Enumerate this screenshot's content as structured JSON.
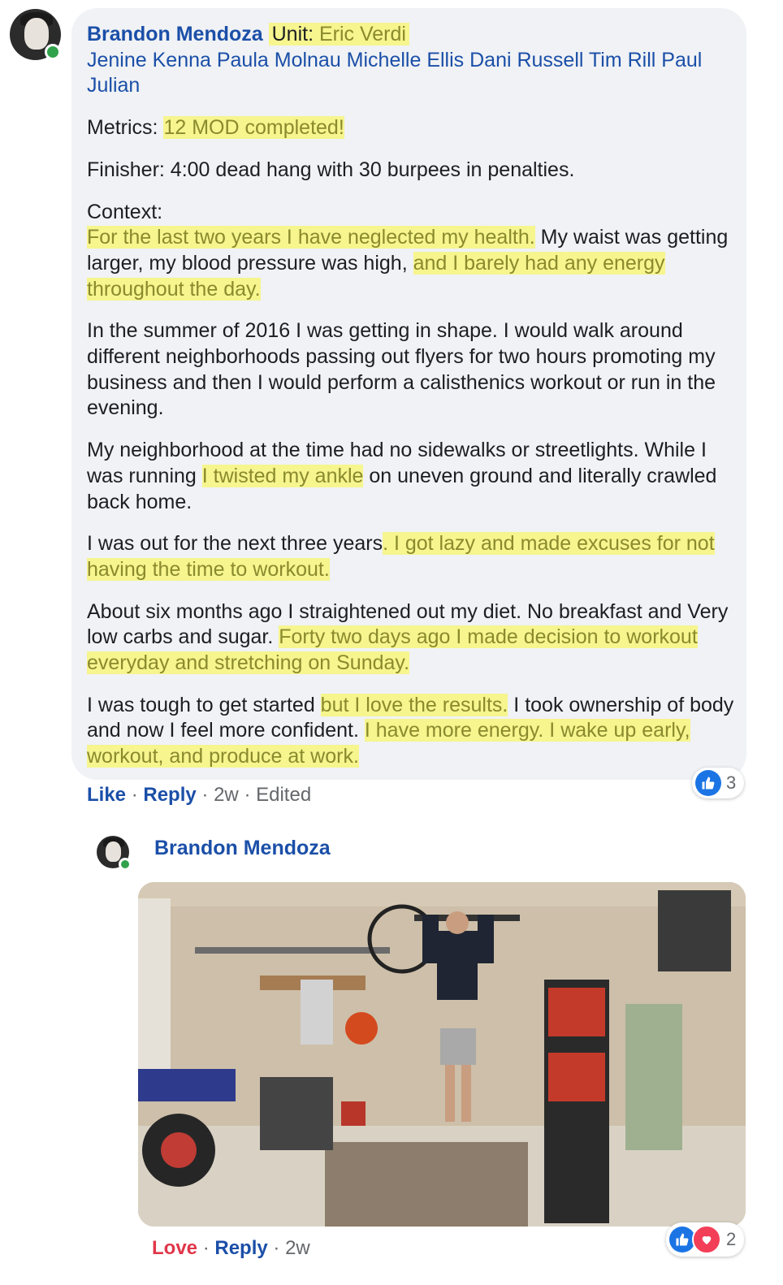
{
  "comment": {
    "author": "Brandon Mendoza",
    "unit_label": "Unit:",
    "unit_name": "Eric Verdi",
    "tags": "Jenine Kenna Paula Molnau Michelle Ellis Dani Russell Tim Rill Paul Julian",
    "metrics_label": "Metrics:",
    "metrics_value": "12 MOD completed!",
    "finisher": "Finisher: 4:00 dead hang with 30 burpees in penalties.",
    "context_label": "Context:",
    "context_hl1": "For the last two years I have neglected my health.",
    "context_t1": " My waist was getting larger, my blood pressure was high, ",
    "context_hl2": "and I barely had any energy throughout the day.",
    "para2": "In the summer of 2016 I was getting in shape. I would walk around different neighborhoods passing out flyers for two hours promoting my business and then I would perform a calisthenics workout or run in the evening.",
    "para3_t1": "My neighborhood at the time had no sidewalks or streetlights. While I was running ",
    "para3_hl": "I twisted my ankle",
    "para3_t2": " on uneven ground and literally crawled back home.",
    "para4_t1": "I was out for the next three years",
    "para4_hl": ". I got lazy and made excuses for not having the time to workout.",
    "para5_t1": "About six months ago I straightened out my diet. No breakfast and Very low carbs and sugar. ",
    "para5_hl": "Forty two days ago I made decision to workout everyday and stretching on Sunday.",
    "para6_t1": "I was tough to get started ",
    "para6_hl1": "but I love the results.",
    "para6_t2": " I took ownership of body and now I feel more confident. ",
    "para6_hl2": "I have more energy. I wake up early, workout, and produce at work.",
    "actions": {
      "like": "Like",
      "reply": "Reply",
      "time": "2w",
      "edited": "Edited",
      "sep": "·"
    },
    "reaction_count": "3"
  },
  "reply": {
    "author": "Brandon Mendoza",
    "actions": {
      "love": "Love",
      "reply": "Reply",
      "time": "2w",
      "sep": "·"
    },
    "reaction_count": "2"
  },
  "colors": {
    "link": "#1b4fa8",
    "highlight": "#f6f58e",
    "bubble": "#f0f2f5",
    "love": "#e0364a",
    "like": "#1b74e4"
  }
}
